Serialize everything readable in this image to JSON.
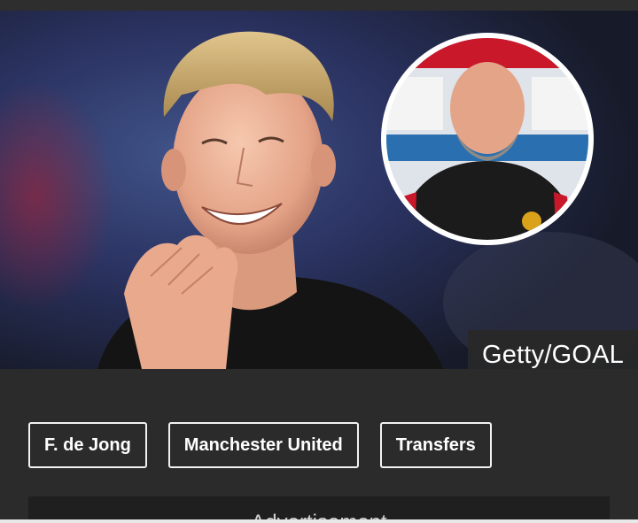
{
  "hero": {
    "image_alt": "Frenkie de Jong applauding with inset of Erik ten Hag",
    "inset_alt": "Erik ten Hag at press conference",
    "credit": "Getty/GOAL"
  },
  "tags": [
    {
      "label": "F. de Jong"
    },
    {
      "label": "Manchester United"
    },
    {
      "label": "Transfers"
    }
  ],
  "advert": {
    "label": "Advertisement"
  },
  "colors": {
    "page_background": "#2b2b2b",
    "tag_border": "#f2f2f2",
    "credit_background": "#282828",
    "advert_background": "#1f1f1f"
  }
}
